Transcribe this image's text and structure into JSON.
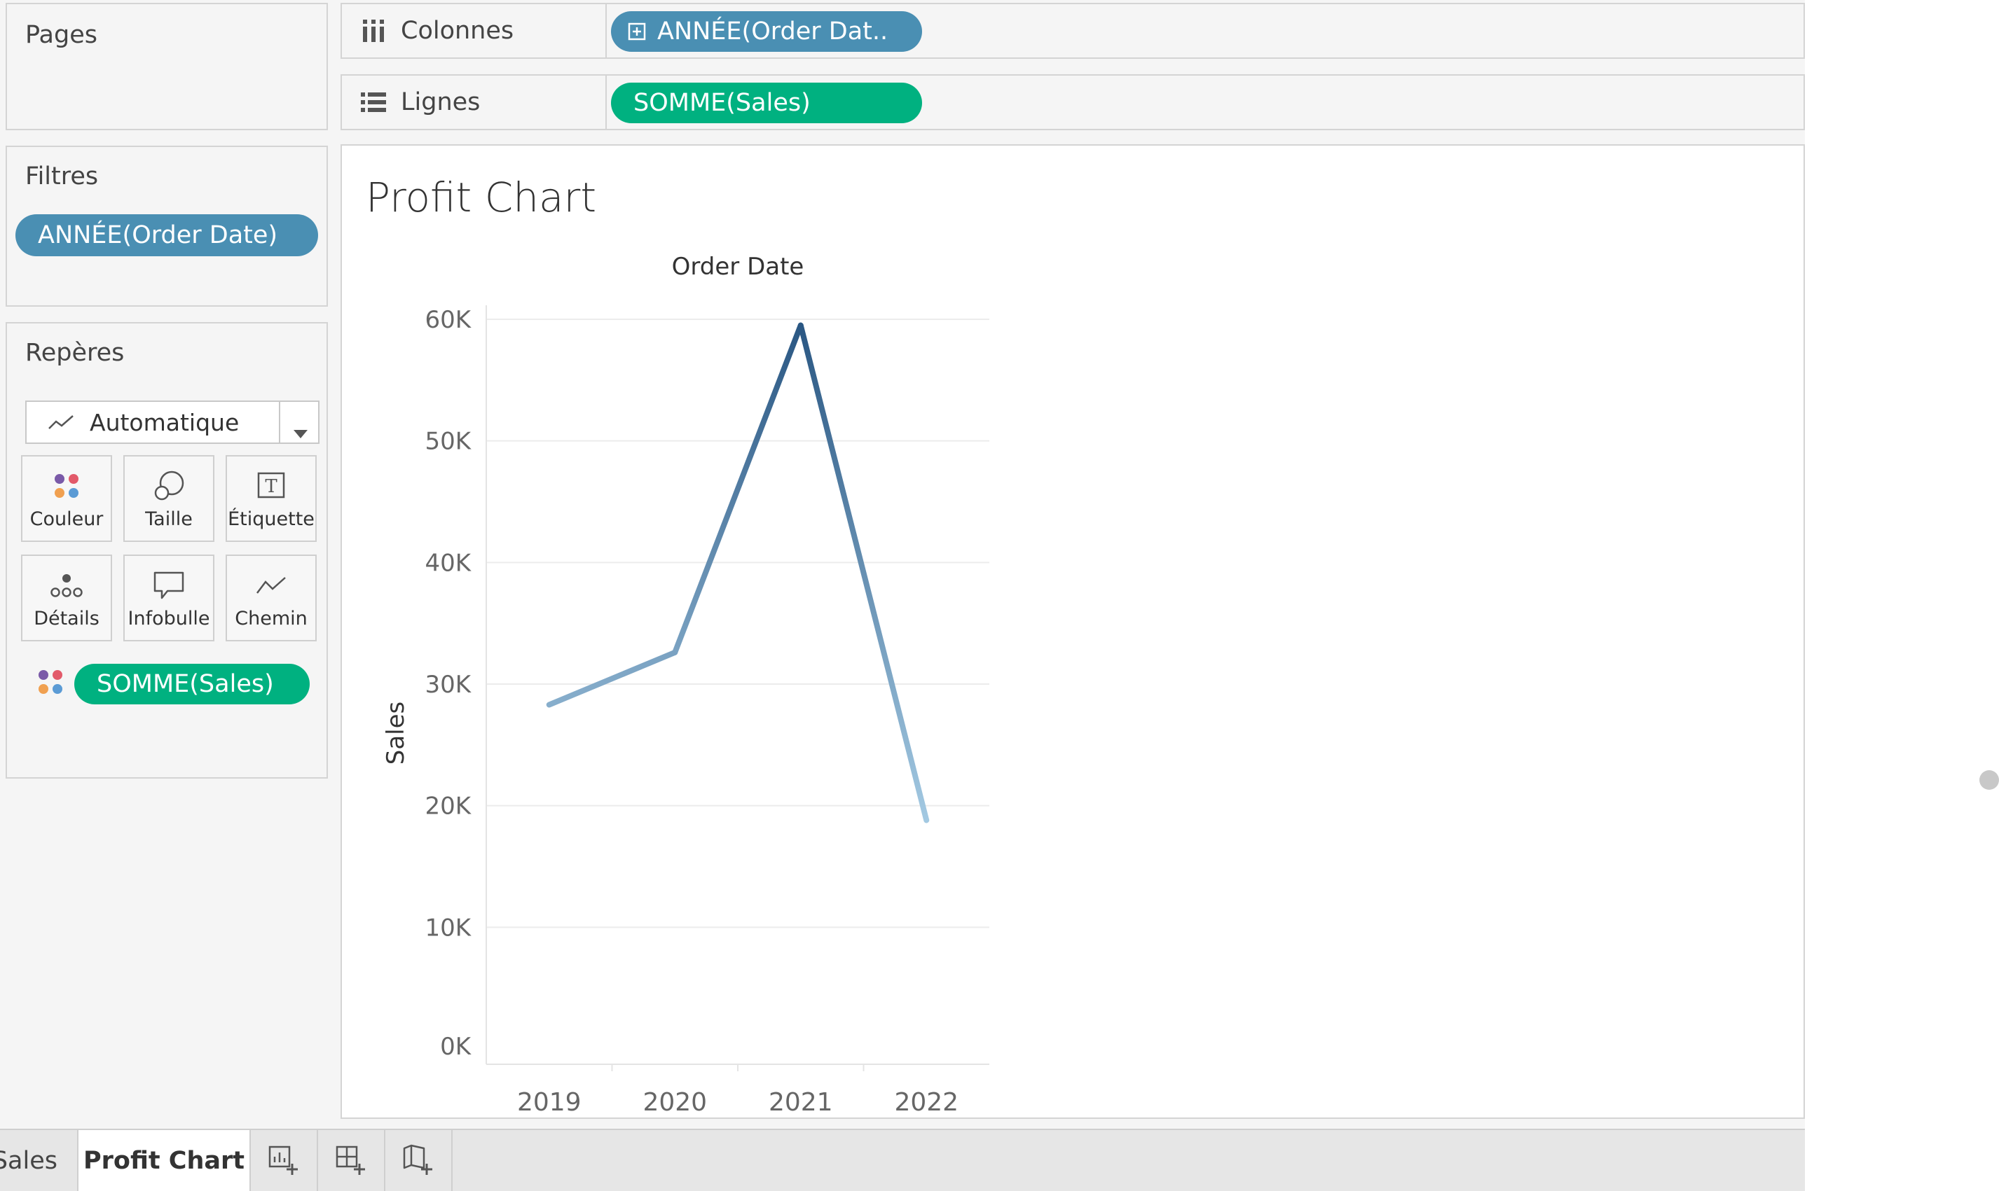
{
  "pages": {
    "title": "Pages"
  },
  "filters": {
    "title": "Filtres",
    "pill": "ANNÉE(Order Date)"
  },
  "marks": {
    "title": "Repères",
    "type": "Automatique",
    "buttons": [
      "Couleur",
      "Taille",
      "Étiquette",
      "Détails",
      "Infobulle",
      "Chemin"
    ],
    "color_pill": "SOMME(Sales)"
  },
  "shelves": {
    "columns": {
      "label": "Colonnes",
      "pill": "ANNÉE(Order Dat.."
    },
    "rows": {
      "label": "Lignes",
      "pill": "SOMME(Sales)"
    }
  },
  "sheet": {
    "title": "Profit Chart"
  },
  "chart_data": {
    "type": "line",
    "title": "Profit Chart",
    "xlabel": "Order Date",
    "ylabel": "Sales",
    "categories": [
      "2019",
      "2020",
      "2021",
      "2022"
    ],
    "values": [
      28300,
      32600,
      59500,
      18800
    ],
    "ylim": [
      0,
      60000
    ],
    "yticks": [
      0,
      10000,
      20000,
      30000,
      40000,
      50000,
      60000
    ],
    "yticklabels": [
      "0K",
      "10K",
      "20K",
      "30K",
      "40K",
      "50K",
      "60K"
    ],
    "grid": true,
    "colors": {
      "low": "#a3c9e2",
      "high": "#2a5783"
    }
  },
  "tabs": {
    "items": [
      "Sales",
      "Profit Chart"
    ],
    "active": "Profit Chart"
  },
  "colors": {
    "blue_pill": "#4a8fb3",
    "green_pill": "#00b180"
  }
}
